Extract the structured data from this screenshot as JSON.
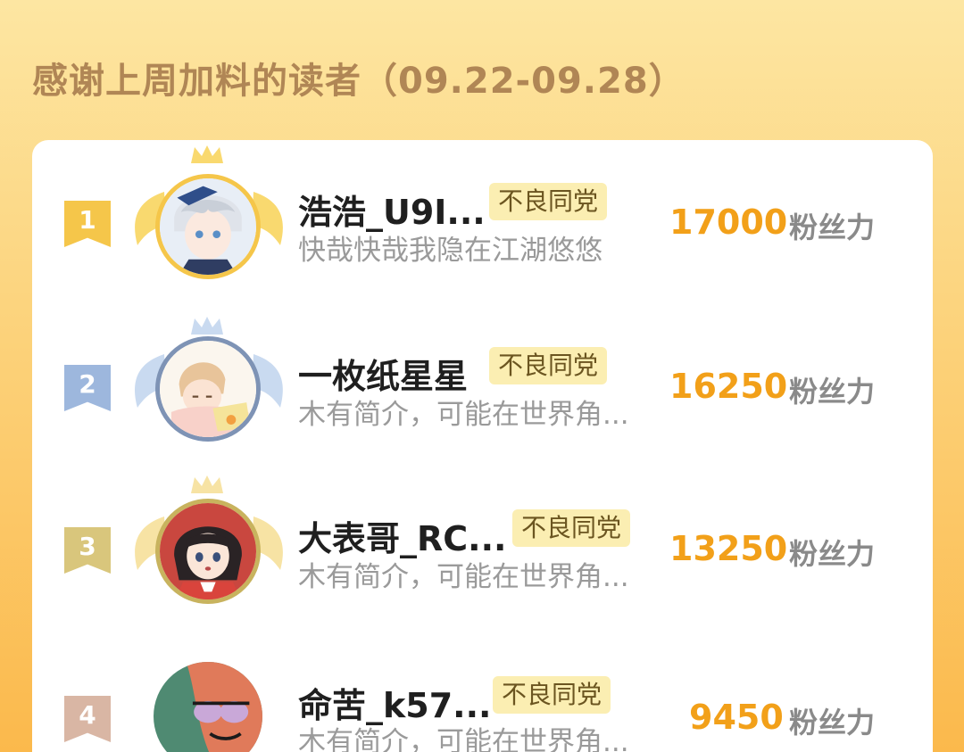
{
  "header": {
    "title": "感谢上周加料的读者（09.22-09.28）"
  },
  "colors": {
    "accent_score": "#f2a019",
    "rank1": "#f5c64a",
    "rank2": "#9db7dd",
    "rank3": "#d9c67c",
    "rank4": "#d9b6a4"
  },
  "readers": [
    {
      "rank": "1",
      "name": "浩浩_U9I...",
      "badge": "不良同党",
      "bio": "快哉快哉我隐在江湖悠悠",
      "score": "17000",
      "unit": "粉丝力",
      "avatar_icon": "anime-boy-avatar-icon"
    },
    {
      "rank": "2",
      "name": "一枚纸星星",
      "badge": "不良同党",
      "bio": "木有简介，可能在世界角...",
      "score": "16250",
      "unit": "粉丝力",
      "avatar_icon": "sleeping-boy-avatar-icon"
    },
    {
      "rank": "3",
      "name": "大表哥_RC...",
      "badge": "不良同党",
      "bio": "木有简介，可能在世界角...",
      "score": "13250",
      "unit": "粉丝力",
      "avatar_icon": "anime-girl-avatar-icon"
    },
    {
      "rank": "4",
      "name": "命苦_k57...",
      "badge": "不良同党",
      "bio": "木有简介，可能在世界角...",
      "score": "9450",
      "unit": "粉丝力",
      "avatar_icon": "cartoon-eyes-avatar-icon"
    }
  ]
}
